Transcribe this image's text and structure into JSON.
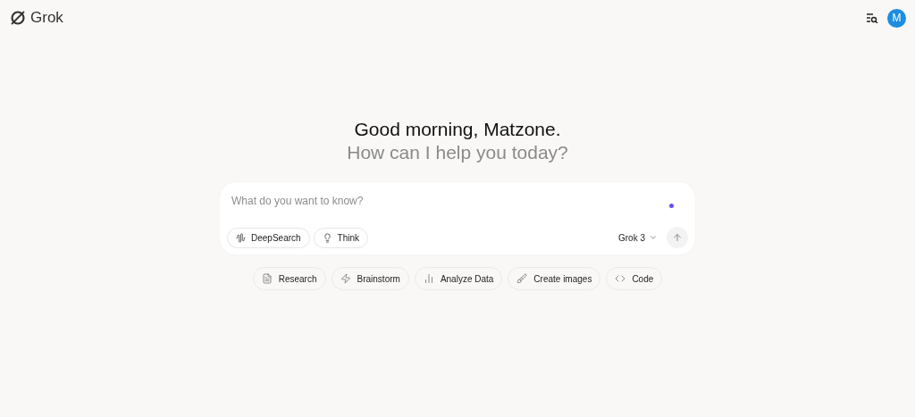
{
  "header": {
    "logo": "Grok",
    "avatar": "M"
  },
  "greeting": {
    "title": "Good morning, Matzone.",
    "subtitle": "How can I help you today?"
  },
  "composer": {
    "placeholder": "What do you want to know?",
    "modes": [
      {
        "label": "DeepSearch",
        "selected": false
      },
      {
        "label": "Think",
        "selected": false
      }
    ],
    "model": "Grok 3"
  },
  "suggestions": [
    "Research",
    "Brainstorm",
    "Analyze Data",
    "Create images",
    "Code"
  ]
}
